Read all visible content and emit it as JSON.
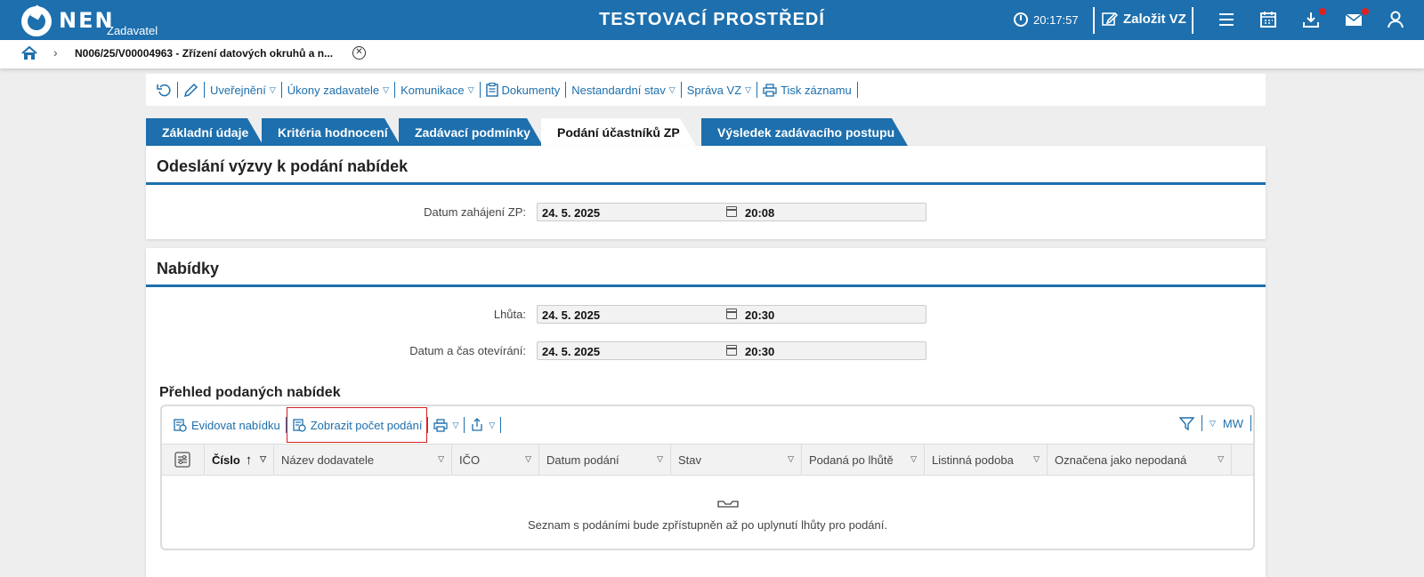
{
  "header": {
    "logo_text": "NEN",
    "logo_sub": "Zadavatel",
    "env_title": "TESTOVACÍ PROSTŘEDÍ",
    "clock": "20:17:57",
    "create_vz": "Založit VZ"
  },
  "breadcrumb": {
    "text": "N006/25/V00004963 - Zřízení datových okruhů a n..."
  },
  "toolbar": {
    "items": [
      "Uveřejnění",
      "Úkony zadavatele",
      "Komunikace",
      "Dokumenty",
      "Nestandardní stav",
      "Správa VZ",
      "Tisk záznamu"
    ]
  },
  "tabs": [
    "Základní údaje",
    "Kritéria hodnocení",
    "Zadávací podmínky",
    "Podání účastníků ZP",
    "Výsledek zadávacího postupu"
  ],
  "section1": {
    "title": "Odeslání výzvy k podání nabídek",
    "fields": [
      {
        "label": "Datum zahájení ZP:",
        "date": "24. 5. 2025",
        "time": "20:08"
      }
    ]
  },
  "section2": {
    "title": "Nabídky",
    "fields": [
      {
        "label": "Lhůta:",
        "date": "24. 5. 2025",
        "time": "20:30"
      },
      {
        "label": "Datum a čas otevírání:",
        "date": "24. 5. 2025",
        "time": "20:30"
      }
    ],
    "grid_title": "Přehled podaných nabídek",
    "grid_toolbar": {
      "evidovat": "Evidovat nabídku",
      "zobrazit": "Zobrazit počet podání",
      "mw": "MW"
    },
    "columns": [
      "Číslo",
      "Název dodavatele",
      "IČO",
      "Datum podání",
      "Stav",
      "Podaná po lhůtě",
      "Listinná podoba",
      "Označena jako nepodaná"
    ],
    "empty_message": "Seznam s podáními bude zpřístupněn až po uplynutí lhůty pro podání."
  }
}
